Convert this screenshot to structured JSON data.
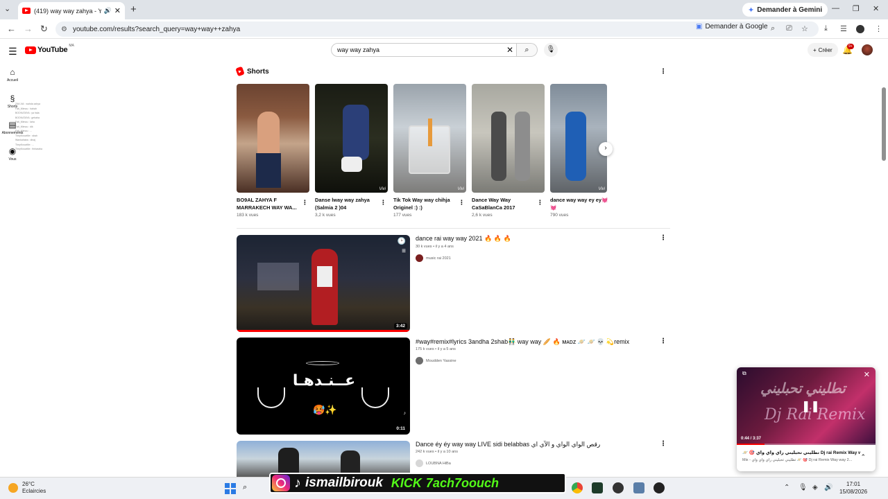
{
  "browser": {
    "tab_title": "(419) way way zahya - YouTube",
    "url": "youtube.com/results?search_query=way+way++zahya",
    "gemini_label": "Demander à Gemini",
    "ask_google_label": "Demander à Google"
  },
  "youtube": {
    "logo_text": "YouTube",
    "country_code": "MA",
    "search_value": "way way  zahya",
    "create_label": "Créer",
    "notif_count": "9+",
    "guide": [
      {
        "label": "Accueil",
        "icon": "home-icon"
      },
      {
        "label": "Shorts",
        "icon": "shorts-icon"
      },
      {
        "label": "Abonnements",
        "icon": "subscriptions-icon"
      },
      {
        "label": "Vous",
        "icon": "you-icon"
      }
    ],
    "chat_overlay": [
      "ZAK-N4 : wahda zahya",
      "Fati_Mimou : hahah",
      "BOOKATAYA : ya hala",
      "BOOKATAYA : gehaha",
      "Fati_Mimou : laha",
      "Fati_Mimou : dik",
      "Fati_Mimou : ...",
      "TheyKnowMe : sbah",
      "Wankahaba : dinaj",
      "TheyKnowMe : ...",
      "TheyKnowMe : finharaha"
    ],
    "shorts": {
      "heading": "Shorts",
      "items": [
        {
          "title": "BO9AL ZAHYA F MARRAKECH WAY WA...",
          "views": "183 k vues"
        },
        {
          "title": "Danse lway way zahya (Salmia 2 )04",
          "views": "3,2 k vues"
        },
        {
          "title": "Tik Tok Way way chihja Originel :) :)",
          "views": "177 vues"
        },
        {
          "title": "Dance Way Way CaSaBlanCa 2017",
          "views": "2,6 k vues"
        },
        {
          "title": "dance way way ey ey💓💓",
          "views": "790 vues"
        }
      ]
    },
    "videos": [
      {
        "title": "dance rai way way 2021 🔥 🔥 🔥",
        "views": "30 k vues",
        "age": "il y a 4 ans",
        "channel": "music rai 2021",
        "duration": "3:42"
      },
      {
        "title": "#way#remix#lyrics 3andha 2shab👬 way way 🥖 🔥 ᴍᴀᴅᴢ 🪐 🪐 💀 💫remix",
        "views": "175 k vues",
        "age": "il y a 5 ans",
        "channel": "Moudden Yassine",
        "duration": "0:11",
        "thumb_text": "عــنـدهـا"
      },
      {
        "title": "Dance éy éy way way LIVE sidi belabbas رقص الواي الواي و الآي اي",
        "views": "242 k vues",
        "age": "il y a 10 ans",
        "channel": "LOUBNA HiBa",
        "duration": ""
      }
    ],
    "miniplayer": {
      "time": "0:44 / 3:37",
      "progress": 0.2,
      "title": "🪐 🎯 تطليني تحبليني راي واي واي Dj rai Remix Way wa...",
      "subtitle": "Mix - تطليني تحبليني راي واي واي 🪐 🎯 Dj rai Remix Way way 2...",
      "thumb_text_1": "تطليني تحبليني",
      "thumb_text_2": "Dj Rai Remix"
    }
  },
  "taskbar": {
    "temp": "26°C",
    "weather": "Eclaircies",
    "banner_name": "ismailbirouk",
    "banner_kick": "KICK",
    "banner_handle": "7ach7oouch",
    "time": "17:01",
    "date": "15/08/2026"
  }
}
